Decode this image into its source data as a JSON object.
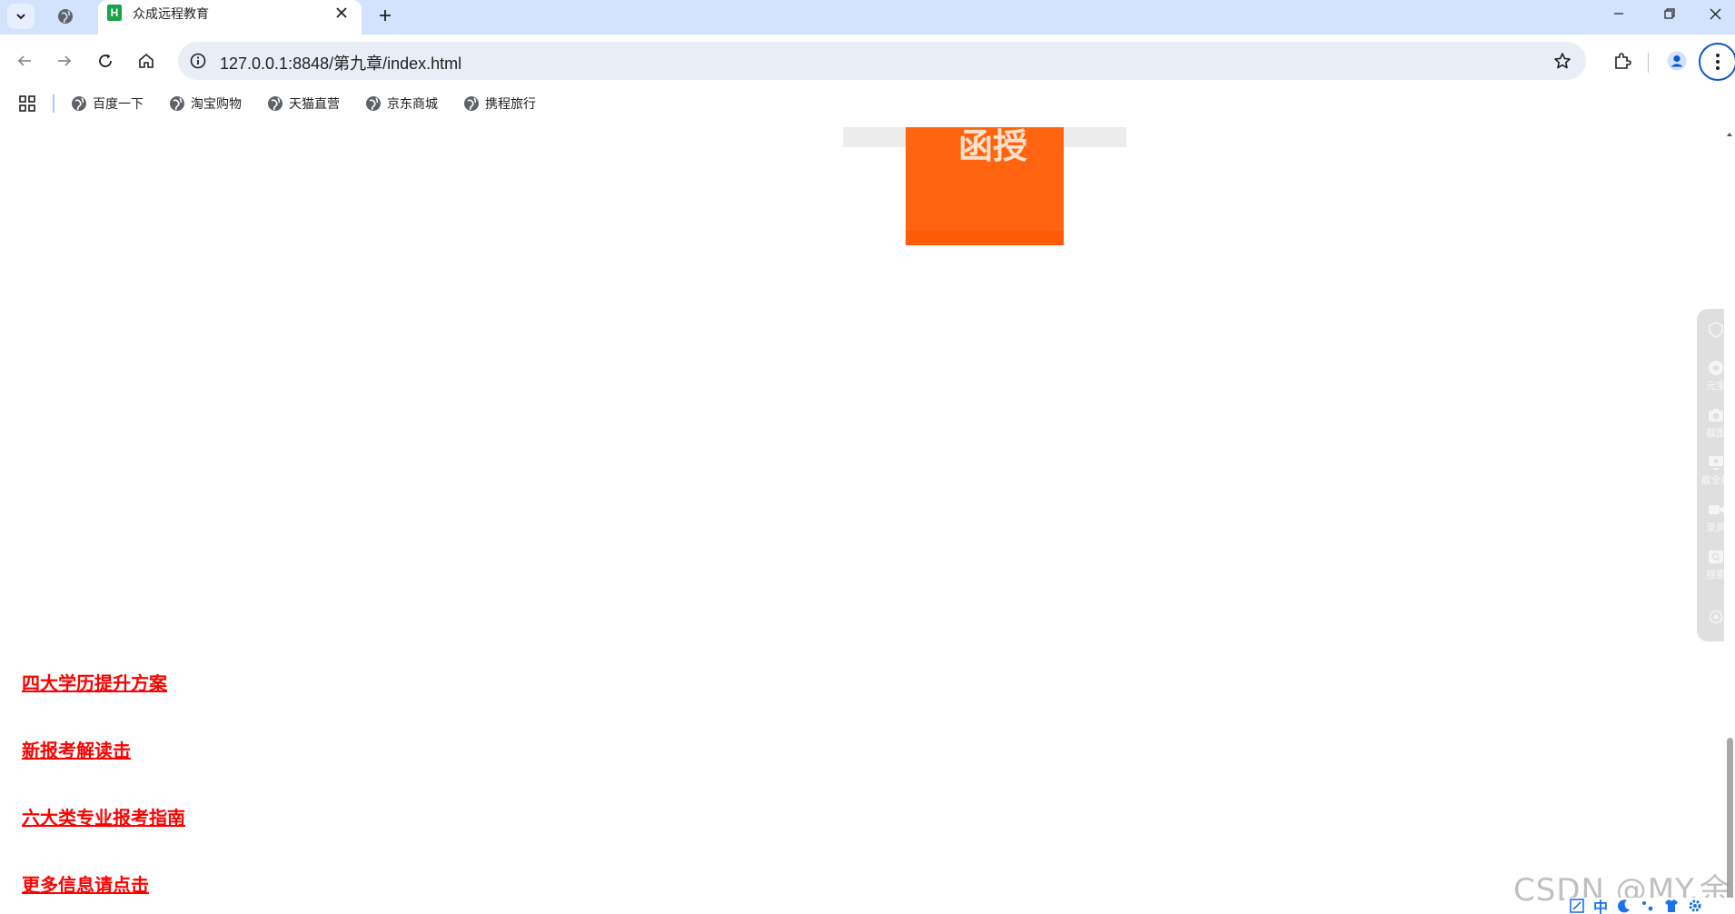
{
  "browser": {
    "tab_title": "众成远程教育",
    "tab_favicon_letter": "H",
    "url": "127.0.0.1:8848/第九章/index.html"
  },
  "bookmarks": [
    {
      "label": "百度一下"
    },
    {
      "label": "淘宝购物"
    },
    {
      "label": "天猫直营"
    },
    {
      "label": "京东商城"
    },
    {
      "label": "携程旅行"
    }
  ],
  "page": {
    "banner_glyph": "函授",
    "links": [
      "四大学历提升方案",
      "新报考解读击",
      "六大类专业报考指南",
      "更多信息请点击"
    ]
  },
  "side_panel": {
    "items": [
      {
        "label": "元宝",
        "icon": "yuanbao-icon"
      },
      {
        "label": "截图",
        "icon": "camera-icon"
      },
      {
        "label": "截全屏",
        "icon": "screen-capture-icon"
      },
      {
        "label": "录屏",
        "icon": "record-icon"
      },
      {
        "label": "搜索",
        "icon": "search-icon"
      }
    ]
  },
  "watermark": "CSDN @MY.余",
  "ime": {
    "lang": "中"
  },
  "colors": {
    "tabstrip": "#d3e3fd",
    "omnibox": "#e9eef6",
    "link": "#ff0000",
    "banner": "#ff6410"
  }
}
